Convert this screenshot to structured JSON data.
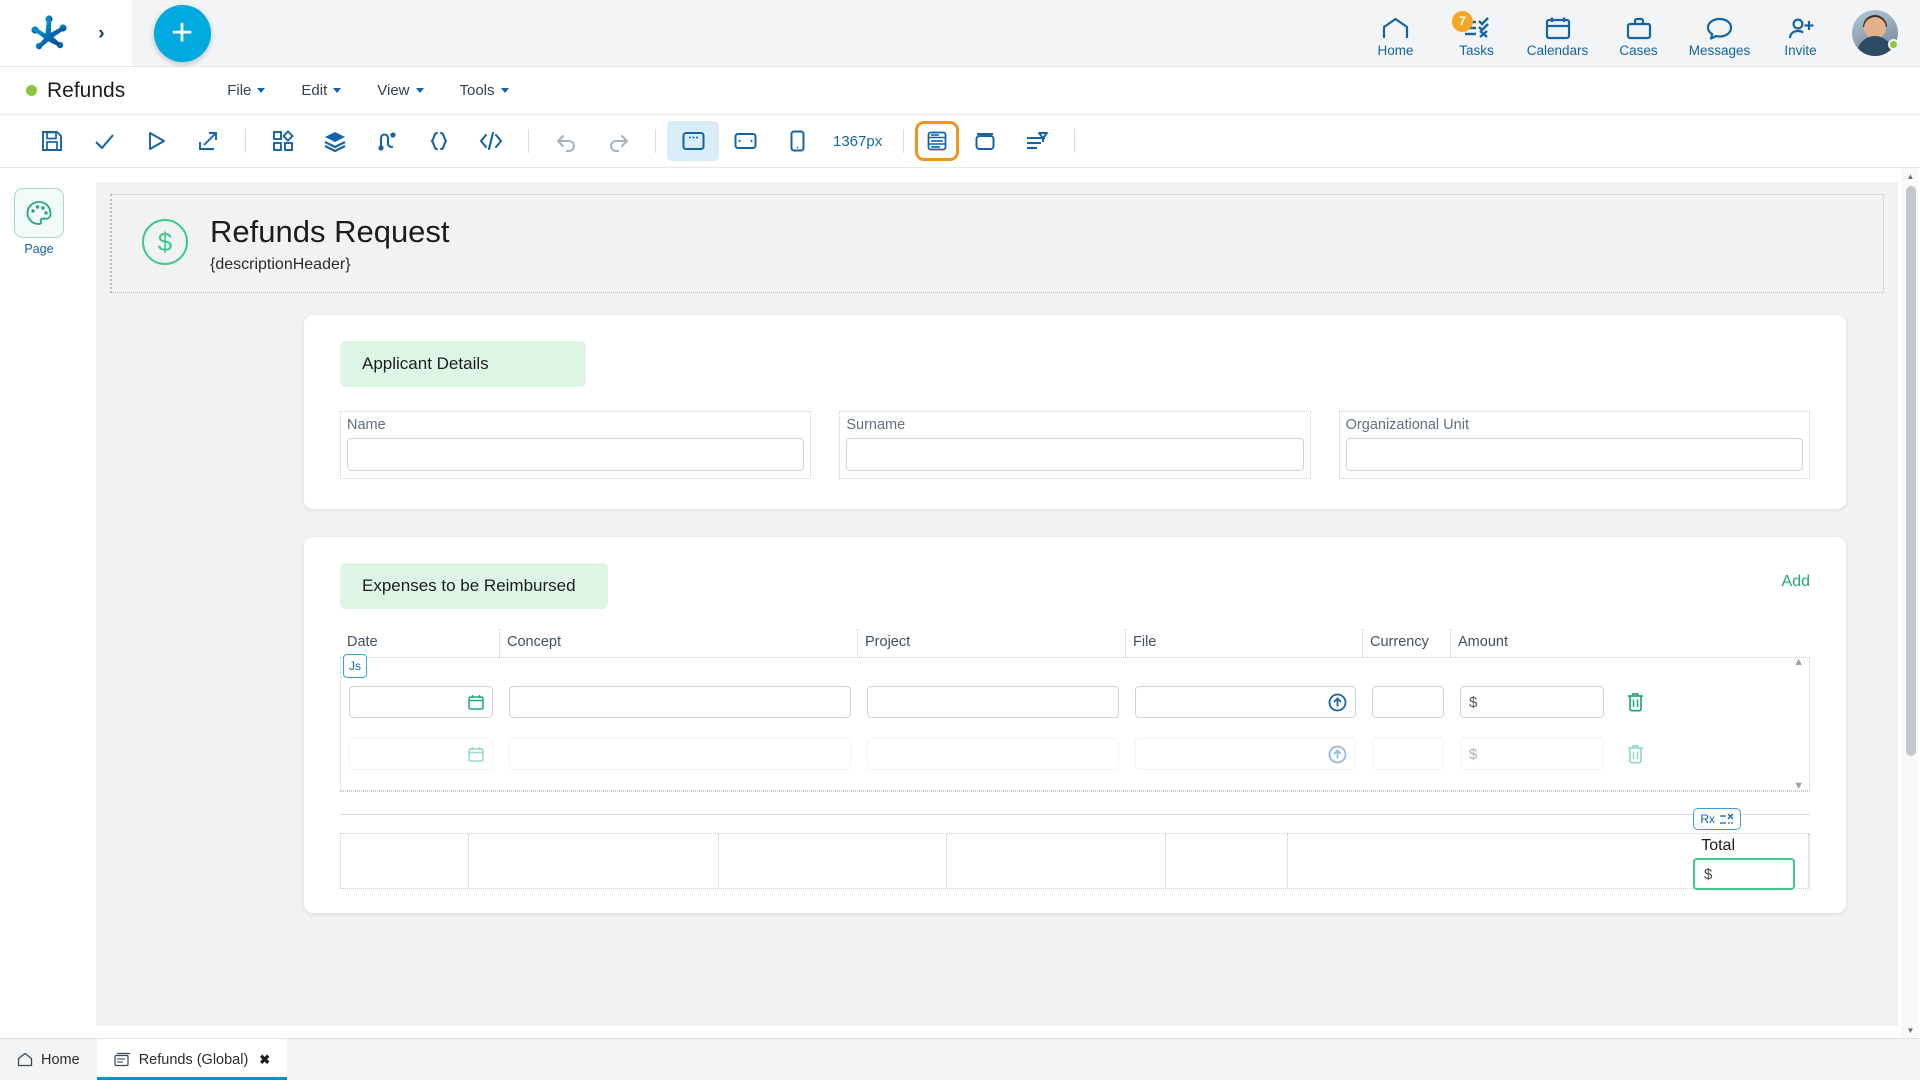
{
  "topbar": {
    "logo_icon": "bizagi-logo-icon",
    "expand_icon": "chevron-right-icon",
    "add_button_label": "+",
    "nav": [
      {
        "label": "Home",
        "icon": "home-icon",
        "badge": null
      },
      {
        "label": "Tasks",
        "icon": "tasks-icon",
        "badge": "7"
      },
      {
        "label": "Calendars",
        "icon": "calendar-icon",
        "badge": null
      },
      {
        "label": "Cases",
        "icon": "briefcase-icon",
        "badge": null
      },
      {
        "label": "Messages",
        "icon": "chat-icon",
        "badge": null
      },
      {
        "label": "Invite",
        "icon": "user-plus-icon",
        "badge": null
      }
    ]
  },
  "appheader": {
    "status_dot_color": "#8cc63f",
    "project_title": "Refunds",
    "menus": [
      {
        "label": "File"
      },
      {
        "label": "Edit"
      },
      {
        "label": "View"
      },
      {
        "label": "Tools"
      }
    ]
  },
  "toolbar": {
    "viewport_width_label": "1367px",
    "items": [
      {
        "name": "save-icon",
        "state": "normal"
      },
      {
        "name": "validate-check-icon",
        "state": "normal"
      },
      {
        "name": "run-play-icon",
        "state": "normal"
      },
      {
        "name": "publish-share-icon",
        "state": "normal"
      },
      {
        "name": "widgets-grid-icon",
        "state": "normal"
      },
      {
        "name": "layers-icon",
        "state": "normal"
      },
      {
        "name": "rules-connector-icon",
        "state": "normal"
      },
      {
        "name": "expression-braces-icon",
        "state": "normal"
      },
      {
        "name": "code-brackets-icon",
        "state": "normal"
      },
      {
        "name": "undo-icon",
        "state": "disabled"
      },
      {
        "name": "redo-icon",
        "state": "disabled"
      },
      {
        "name": "desktop-view-icon",
        "state": "selected-blue"
      },
      {
        "name": "tablet-view-icon",
        "state": "normal"
      },
      {
        "name": "mobile-view-icon",
        "state": "normal"
      },
      {
        "name": "form-layout-icon",
        "state": "selected-orange"
      },
      {
        "name": "container-icon",
        "state": "normal"
      },
      {
        "name": "align-distribute-icon",
        "state": "normal"
      }
    ]
  },
  "leftrail": {
    "page_button_icon": "palette-icon",
    "page_button_label": "Page"
  },
  "form": {
    "header": {
      "icon": "dollar-circle-icon",
      "title": "Refunds Request",
      "subtitle": "{descriptionHeader}"
    },
    "applicant_section": {
      "title": "Applicant Details",
      "fields": [
        {
          "label": "Name",
          "value": "",
          "placeholder": ""
        },
        {
          "label": "Surname",
          "value": "",
          "placeholder": ""
        },
        {
          "label": "Organizational Unit",
          "value": "",
          "placeholder": ""
        }
      ]
    },
    "expenses_section": {
      "title": "Expenses to be Reimbursed",
      "add_label": "Add",
      "js_badge_label": "Js",
      "columns": [
        "Date",
        "Concept",
        "Project",
        "File",
        "Currency",
        "Amount"
      ],
      "rows": [
        {
          "date": "",
          "date_icon": "calendar-icon",
          "concept": "",
          "project": "",
          "file": "",
          "file_icon": "upload-circle-icon",
          "currency": "",
          "amount": "$",
          "delete_icon": "trash-icon",
          "ghost": false
        },
        {
          "date": "",
          "date_icon": "calendar-icon",
          "concept": "",
          "project": "",
          "file": "",
          "file_icon": "upload-circle-icon",
          "currency": "",
          "amount": "$",
          "delete_icon": "trash-icon",
          "ghost": true
        }
      ],
      "scroll_up_icon": "caret-up-icon",
      "scroll_down_icon": "caret-down-icon"
    },
    "total_section": {
      "rx_badge_label": "Rx",
      "rx_badge_icon": "formula-icon",
      "total_label": "Total",
      "total_value": "$"
    }
  },
  "tabbar": {
    "tabs": [
      {
        "label": "Home",
        "icon": "home-outline-icon",
        "active": false,
        "closable": false
      },
      {
        "label": "Refunds (Global)",
        "icon": "form-tab-icon",
        "active": true,
        "closable": true
      }
    ],
    "close_glyph": "✖"
  },
  "colors": {
    "accent_blue": "#1464a5",
    "cyan": "#00a9e0",
    "green": "#3dc98a",
    "badge_orange": "#f5a623",
    "highlight_orange": "#f0941e",
    "section_badge_bg": "#def5e6",
    "canvas_bg": "#f0f2f3"
  }
}
